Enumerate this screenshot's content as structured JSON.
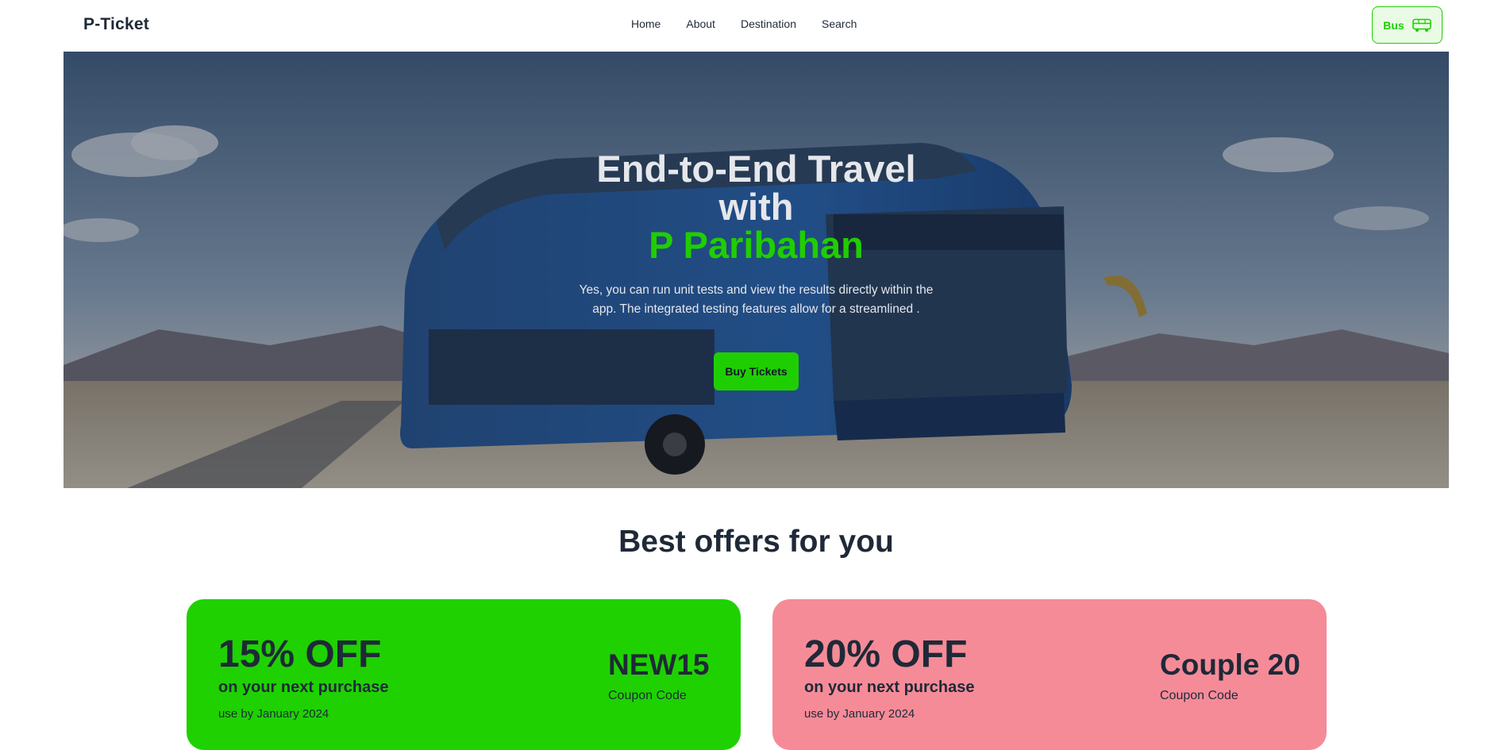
{
  "navbar": {
    "brand": "P-Ticket",
    "links": [
      "Home",
      "About",
      "Destination",
      "Search"
    ],
    "bus_button": {
      "label": "Bus",
      "icon": "bus-icon"
    }
  },
  "hero": {
    "title_line1": "End-to-End Travel",
    "title_line2": "with",
    "title_accent": "P Paribahan",
    "description": "Yes, you can run unit tests and view the results directly within the app. The integrated testing features allow for a streamlined .",
    "cta": "Buy Tickets"
  },
  "offers": {
    "heading": "Best offers for you",
    "cards": [
      {
        "discount": "15% OFF",
        "subtitle": "on your next purchase",
        "validity": "use by January 2024",
        "code": "NEW15",
        "code_label": "Coupon Code",
        "color": "#1fd100"
      },
      {
        "discount": "20% OFF",
        "subtitle": "on your next purchase",
        "validity": "use by January 2024",
        "code": "Couple 20",
        "code_label": "Coupon Code",
        "color": "#f68b98"
      }
    ]
  },
  "colors": {
    "accent": "#1fce00",
    "text_dark": "#1f2937",
    "pink": "#f68b98"
  }
}
